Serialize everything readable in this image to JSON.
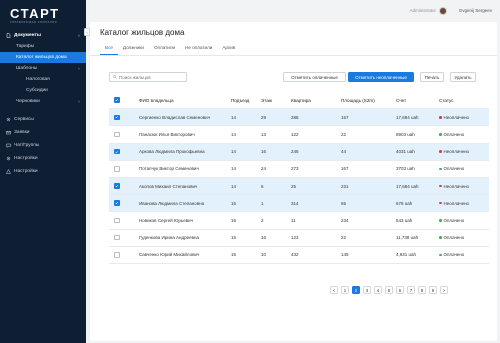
{
  "app": {
    "logo": "СТАРТ",
    "logo_sub": "УПРАВЛЯЮЩАЯ КОМПАНИЯ"
  },
  "topbar": {
    "role": "Administrator",
    "user": "Evgenij Sergeev"
  },
  "sidebar": {
    "documents": "Документы",
    "tariffs": "Тарифы",
    "residents_catalog": "Каталог жильцов дома",
    "templates": "Шаблоны",
    "templates_sub": [
      "Налоговая",
      "Субсидии"
    ],
    "drafts": "Черновики",
    "bottom": [
      {
        "label": "Сервисы",
        "icon": "gear-icon"
      },
      {
        "label": "Заявки",
        "icon": "mail-icon"
      },
      {
        "label": "Чат/Группы",
        "icon": "chat-icon"
      },
      {
        "label": "Настройки",
        "icon": "gear-icon"
      },
      {
        "label": "Настройки",
        "icon": "warning-icon"
      }
    ]
  },
  "main": {
    "title": "Каталог жильцов дома",
    "tabs": [
      "Все",
      "Должники",
      "Оплатили",
      "Не оплатили",
      "Архив"
    ],
    "active_tab": 0,
    "search_placeholder": "Поиск жильцов",
    "buttons": {
      "mark_paid": "Отметить оплаченные",
      "mark_unpaid": "Отметить неоплаченные",
      "print": "Печать",
      "delete": "Удалить"
    }
  },
  "table": {
    "columns": [
      "ФИО владельца",
      "Подъезд",
      "Этаж",
      "Квартира",
      "Площадь (S2m)",
      "Счет",
      "Статус"
    ],
    "rows": [
      {
        "checked": true,
        "name": "Сергиенко Владислав Семенович",
        "entrance": "14",
        "floor": "29",
        "apt": "288",
        "area": "157",
        "bill": "17,684 uah",
        "status": "Неоплачено"
      },
      {
        "checked": false,
        "name": "Панасюк Илья Викторович",
        "entrance": "14",
        "floor": "13",
        "apt": "122",
        "area": "22",
        "bill": "8903 uah",
        "status": "Оплачено"
      },
      {
        "checked": true,
        "name": "Аркова Людмила Прокофьевна",
        "entrance": "14",
        "floor": "16",
        "apt": "245",
        "area": "44",
        "bill": "4031 uah",
        "status": "Неоплачено"
      },
      {
        "checked": false,
        "name": "Потапчук Виктор Семенович",
        "entrance": "14",
        "floor": "24",
        "apt": "273",
        "area": "167",
        "bill": "3703 uah",
        "status": "Оплачено"
      },
      {
        "checked": true,
        "name": "Акопов Михаил Степанович",
        "entrance": "14",
        "floor": "6",
        "apt": "25",
        "area": "231",
        "bill": "17,684 uah",
        "status": "Неоплачено"
      },
      {
        "checked": true,
        "name": "Иванова Людмила Степановна",
        "entrance": "15",
        "floor": "1",
        "apt": "314",
        "area": "65",
        "bill": "678 uah",
        "status": "Неоплачено"
      },
      {
        "checked": false,
        "name": "Новиков Сергей Юрьевич",
        "entrance": "15",
        "floor": "2",
        "apt": "11",
        "area": "234",
        "bill": "543 uah",
        "status": "Оплачено"
      },
      {
        "checked": false,
        "name": "Гуденкова Ирина Андреевна",
        "entrance": "15",
        "floor": "16",
        "apt": "123",
        "area": "22",
        "bill": "11,738 uah",
        "status": "Оплачено"
      },
      {
        "checked": false,
        "name": "Савченко Юрий Михайлович",
        "entrance": "15",
        "floor": "10",
        "apt": "432",
        "area": "145",
        "bill": "4,931 uah",
        "status": "Оплачено"
      }
    ]
  },
  "pagination": {
    "prev": "<",
    "next": ">",
    "pages": [
      "1",
      "2",
      "3",
      "4",
      "5",
      "6",
      "7",
      "8",
      "9"
    ],
    "current": "2"
  },
  "colors": {
    "accent": "#1b7ae0",
    "sidebar": "#0f1f33",
    "paid": "#3cb44b",
    "unpaid": "#e53935",
    "selected_row": "#e3f1fc"
  }
}
